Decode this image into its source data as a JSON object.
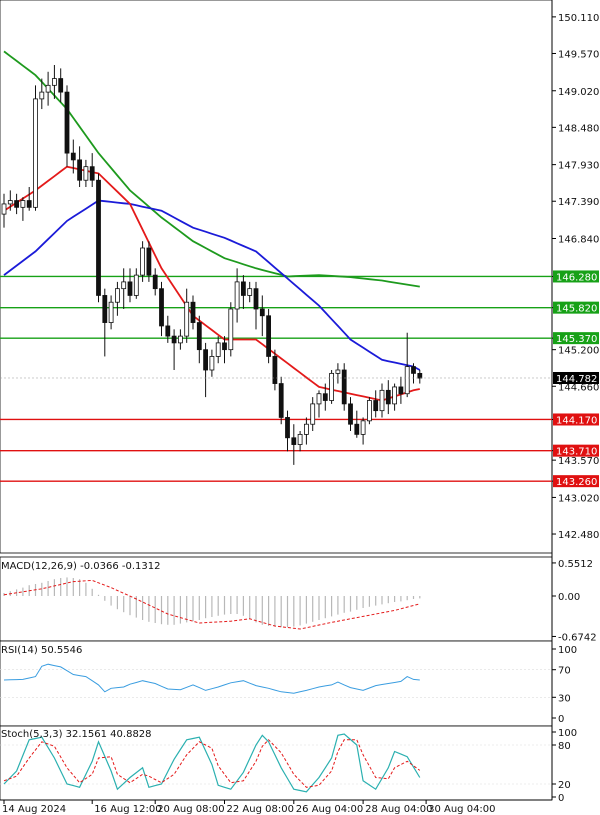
{
  "chart_data": {
    "type": "candlestick",
    "symbol_timeframe": "USDJPY H4",
    "price_axis": {
      "range": [
        142.2,
        150.3
      ],
      "ticks": [
        "150.110",
        "149.570",
        "149.020",
        "148.480",
        "147.930",
        "147.390",
        "146.840",
        "146.280",
        "145.820",
        "145.370",
        "145.200",
        "144.660",
        "144.170",
        "143.710",
        "143.570",
        "143.260",
        "143.020",
        "142.480"
      ],
      "current_price_label": "144.782",
      "current_price": 144.782
    },
    "horizontal_levels": {
      "resistance": [
        146.28,
        145.82,
        145.37
      ],
      "support": [
        144.17,
        143.71,
        143.26
      ],
      "resistance_color": "#17a117",
      "support_color": "#e01010"
    },
    "candles": [
      {
        "o": 147.2,
        "h": 147.5,
        "l": 147.0,
        "c": 147.35
      },
      {
        "o": 147.35,
        "h": 147.55,
        "l": 147.25,
        "c": 147.4
      },
      {
        "o": 147.4,
        "h": 147.5,
        "l": 147.2,
        "c": 147.3
      },
      {
        "o": 147.3,
        "h": 147.45,
        "l": 147.1,
        "c": 147.4
      },
      {
        "o": 147.4,
        "h": 147.6,
        "l": 147.25,
        "c": 147.3
      },
      {
        "o": 147.3,
        "h": 149.1,
        "l": 147.25,
        "c": 148.9
      },
      {
        "o": 148.9,
        "h": 149.2,
        "l": 148.75,
        "c": 149.0
      },
      {
        "o": 149.0,
        "h": 149.3,
        "l": 148.8,
        "c": 149.1
      },
      {
        "o": 149.1,
        "h": 149.4,
        "l": 148.9,
        "c": 149.2
      },
      {
        "o": 149.2,
        "h": 149.35,
        "l": 148.85,
        "c": 149.0
      },
      {
        "o": 149.0,
        "h": 149.1,
        "l": 147.9,
        "c": 148.1
      },
      {
        "o": 148.1,
        "h": 148.3,
        "l": 147.8,
        "c": 148.0
      },
      {
        "o": 148.0,
        "h": 148.2,
        "l": 147.6,
        "c": 147.7
      },
      {
        "o": 147.7,
        "h": 148.0,
        "l": 147.6,
        "c": 147.9
      },
      {
        "o": 147.9,
        "h": 148.1,
        "l": 147.6,
        "c": 147.7
      },
      {
        "o": 147.7,
        "h": 147.8,
        "l": 145.9,
        "c": 146.0
      },
      {
        "o": 146.0,
        "h": 146.1,
        "l": 145.1,
        "c": 145.6
      },
      {
        "o": 145.6,
        "h": 146.0,
        "l": 145.5,
        "c": 145.9
      },
      {
        "o": 145.9,
        "h": 146.2,
        "l": 145.7,
        "c": 146.1
      },
      {
        "o": 146.1,
        "h": 146.4,
        "l": 145.8,
        "c": 146.2
      },
      {
        "o": 146.2,
        "h": 146.4,
        "l": 145.9,
        "c": 146.0
      },
      {
        "o": 146.0,
        "h": 146.4,
        "l": 145.95,
        "c": 146.3
      },
      {
        "o": 146.3,
        "h": 146.8,
        "l": 146.2,
        "c": 146.7
      },
      {
        "o": 146.7,
        "h": 146.8,
        "l": 146.2,
        "c": 146.3
      },
      {
        "o": 146.3,
        "h": 146.4,
        "l": 146.0,
        "c": 146.1
      },
      {
        "o": 146.1,
        "h": 146.2,
        "l": 145.4,
        "c": 145.55
      },
      {
        "o": 145.55,
        "h": 145.7,
        "l": 145.3,
        "c": 145.4
      },
      {
        "o": 145.4,
        "h": 145.5,
        "l": 144.9,
        "c": 145.3
      },
      {
        "o": 145.3,
        "h": 145.5,
        "l": 145.2,
        "c": 145.4
      },
      {
        "o": 145.4,
        "h": 146.1,
        "l": 145.3,
        "c": 145.9
      },
      {
        "o": 145.9,
        "h": 146.0,
        "l": 145.5,
        "c": 145.6
      },
      {
        "o": 145.6,
        "h": 145.7,
        "l": 145.0,
        "c": 145.2
      },
      {
        "o": 145.2,
        "h": 145.3,
        "l": 144.5,
        "c": 144.9
      },
      {
        "o": 144.9,
        "h": 145.2,
        "l": 144.8,
        "c": 145.1
      },
      {
        "o": 145.1,
        "h": 145.4,
        "l": 145.0,
        "c": 145.3
      },
      {
        "o": 145.3,
        "h": 145.4,
        "l": 145.0,
        "c": 145.2
      },
      {
        "o": 145.2,
        "h": 145.9,
        "l": 145.1,
        "c": 145.8
      },
      {
        "o": 145.8,
        "h": 146.4,
        "l": 145.6,
        "c": 146.2
      },
      {
        "o": 146.2,
        "h": 146.3,
        "l": 145.8,
        "c": 146.0
      },
      {
        "o": 146.0,
        "h": 146.2,
        "l": 145.9,
        "c": 146.1
      },
      {
        "o": 146.1,
        "h": 146.2,
        "l": 145.5,
        "c": 145.8
      },
      {
        "o": 145.8,
        "h": 146.0,
        "l": 145.4,
        "c": 145.7
      },
      {
        "o": 145.7,
        "h": 145.8,
        "l": 145.0,
        "c": 145.1
      },
      {
        "o": 145.1,
        "h": 145.2,
        "l": 144.6,
        "c": 144.7
      },
      {
        "o": 144.7,
        "h": 144.8,
        "l": 144.1,
        "c": 144.2
      },
      {
        "o": 144.2,
        "h": 144.3,
        "l": 143.7,
        "c": 143.9
      },
      {
        "o": 143.9,
        "h": 144.1,
        "l": 143.5,
        "c": 143.8
      },
      {
        "o": 143.8,
        "h": 144.0,
        "l": 143.7,
        "c": 143.95
      },
      {
        "o": 143.95,
        "h": 144.2,
        "l": 143.8,
        "c": 144.1
      },
      {
        "o": 144.1,
        "h": 144.5,
        "l": 144.0,
        "c": 144.4
      },
      {
        "o": 144.4,
        "h": 144.6,
        "l": 144.2,
        "c": 144.55
      },
      {
        "o": 144.55,
        "h": 144.7,
        "l": 144.3,
        "c": 144.45
      },
      {
        "o": 144.45,
        "h": 144.9,
        "l": 144.4,
        "c": 144.85
      },
      {
        "o": 144.85,
        "h": 145.0,
        "l": 144.7,
        "c": 144.9
      },
      {
        "o": 144.9,
        "h": 145.0,
        "l": 144.3,
        "c": 144.4
      },
      {
        "o": 144.4,
        "h": 144.5,
        "l": 144.0,
        "c": 144.1
      },
      {
        "o": 144.1,
        "h": 144.3,
        "l": 143.9,
        "c": 143.95
      },
      {
        "o": 143.95,
        "h": 144.2,
        "l": 143.8,
        "c": 144.15
      },
      {
        "o": 144.15,
        "h": 144.5,
        "l": 144.1,
        "c": 144.45
      },
      {
        "o": 144.45,
        "h": 144.6,
        "l": 144.2,
        "c": 144.3
      },
      {
        "o": 144.3,
        "h": 144.7,
        "l": 144.2,
        "c": 144.6
      },
      {
        "o": 144.6,
        "h": 144.75,
        "l": 144.25,
        "c": 144.4
      },
      {
        "o": 144.4,
        "h": 144.7,
        "l": 144.3,
        "c": 144.65
      },
      {
        "o": 144.65,
        "h": 144.8,
        "l": 144.4,
        "c": 144.55
      },
      {
        "o": 144.55,
        "h": 145.45,
        "l": 144.5,
        "c": 144.95
      },
      {
        "o": 144.95,
        "h": 145.0,
        "l": 144.7,
        "c": 144.85
      },
      {
        "o": 144.85,
        "h": 144.9,
        "l": 144.7,
        "c": 144.78
      }
    ],
    "moving_averages": {
      "colors": {
        "ma_fast": "#e41a1a",
        "ma_mid": "#1b1bd8",
        "ma_slow": "#1e9a1e"
      },
      "ma_fast": [
        [
          0,
          147.25
        ],
        [
          5,
          147.55
        ],
        [
          10,
          147.9
        ],
        [
          15,
          147.8
        ],
        [
          20,
          147.35
        ],
        [
          25,
          146.4
        ],
        [
          30,
          145.7
        ],
        [
          35,
          145.35
        ],
        [
          40,
          145.35
        ],
        [
          45,
          145.0
        ],
        [
          50,
          144.65
        ],
        [
          55,
          144.55
        ],
        [
          60,
          144.45
        ],
        [
          65,
          144.6
        ],
        [
          66,
          144.62
        ]
      ],
      "ma_mid": [
        [
          0,
          146.3
        ],
        [
          5,
          146.65
        ],
        [
          10,
          147.1
        ],
        [
          15,
          147.4
        ],
        [
          20,
          147.35
        ],
        [
          25,
          147.25
        ],
        [
          30,
          147.0
        ],
        [
          35,
          146.85
        ],
        [
          40,
          146.65
        ],
        [
          45,
          146.25
        ],
        [
          50,
          145.85
        ],
        [
          55,
          145.35
        ],
        [
          60,
          145.05
        ],
        [
          65,
          144.95
        ],
        [
          66,
          144.9
        ]
      ],
      "ma_slow": [
        [
          0,
          149.6
        ],
        [
          5,
          149.25
        ],
        [
          10,
          148.75
        ],
        [
          15,
          148.1
        ],
        [
          20,
          147.55
        ],
        [
          25,
          147.15
        ],
        [
          30,
          146.8
        ],
        [
          35,
          146.55
        ],
        [
          40,
          146.4
        ],
        [
          45,
          146.28
        ],
        [
          50,
          146.3
        ],
        [
          55,
          146.27
        ],
        [
          60,
          146.22
        ],
        [
          66,
          146.13
        ]
      ]
    },
    "macd": {
      "label": "MACD(12,26,9) -0.0366 -0.1312",
      "ticks": [
        "0.5512",
        "0.00",
        "-0.6742"
      ],
      "range": [
        -0.7,
        0.6
      ],
      "histogram": [
        0.05,
        0.08,
        0.11,
        0.14,
        0.18,
        0.2,
        0.22,
        0.25,
        0.28,
        0.3,
        0.31,
        0.3,
        0.28,
        0.22,
        0.12,
        0.02,
        -0.08,
        -0.16,
        -0.22,
        -0.27,
        -0.32,
        -0.36,
        -0.4,
        -0.43,
        -0.45,
        -0.47,
        -0.48,
        -0.48,
        -0.46,
        -0.44,
        -0.42,
        -0.4,
        -0.37,
        -0.35,
        -0.33,
        -0.31,
        -0.3,
        -0.3,
        -0.33,
        -0.38,
        -0.44,
        -0.48,
        -0.5,
        -0.51,
        -0.52,
        -0.52,
        -0.51,
        -0.49,
        -0.46,
        -0.43,
        -0.4,
        -0.37,
        -0.34,
        -0.31,
        -0.28,
        -0.26,
        -0.23,
        -0.2,
        -0.18,
        -0.16,
        -0.14,
        -0.12,
        -0.1,
        -0.09,
        -0.07,
        -0.05,
        -0.04
      ],
      "signal": [
        [
          0,
          0.02
        ],
        [
          6,
          0.12
        ],
        [
          11,
          0.24
        ],
        [
          14,
          0.26
        ],
        [
          17,
          0.14
        ],
        [
          21,
          -0.05
        ],
        [
          26,
          -0.3
        ],
        [
          31,
          -0.45
        ],
        [
          36,
          -0.42
        ],
        [
          39,
          -0.38
        ],
        [
          43,
          -0.5
        ],
        [
          47,
          -0.55
        ],
        [
          52,
          -0.44
        ],
        [
          57,
          -0.34
        ],
        [
          62,
          -0.24
        ],
        [
          66,
          -0.13
        ]
      ]
    },
    "rsi": {
      "label": "RSI(14) 50.5546",
      "ticks": [
        "100",
        "70",
        "30",
        "0"
      ],
      "range": [
        0,
        100
      ],
      "values": [
        [
          0,
          55
        ],
        [
          3,
          56
        ],
        [
          5,
          60
        ],
        [
          6,
          75
        ],
        [
          7,
          78
        ],
        [
          9,
          74
        ],
        [
          11,
          63
        ],
        [
          13,
          60
        ],
        [
          15,
          48
        ],
        [
          16,
          38
        ],
        [
          17,
          43
        ],
        [
          19,
          45
        ],
        [
          20,
          49
        ],
        [
          22,
          54
        ],
        [
          24,
          50
        ],
        [
          26,
          42
        ],
        [
          28,
          41
        ],
        [
          30,
          48
        ],
        [
          32,
          40
        ],
        [
          34,
          45
        ],
        [
          36,
          51
        ],
        [
          38,
          54
        ],
        [
          40,
          47
        ],
        [
          42,
          43
        ],
        [
          44,
          38
        ],
        [
          46,
          36
        ],
        [
          48,
          40
        ],
        [
          50,
          45
        ],
        [
          52,
          48
        ],
        [
          53,
          52
        ],
        [
          55,
          44
        ],
        [
          57,
          40
        ],
        [
          59,
          47
        ],
        [
          61,
          50
        ],
        [
          63,
          53
        ],
        [
          64,
          60
        ],
        [
          65,
          56
        ],
        [
          66,
          55
        ]
      ]
    },
    "stochastic": {
      "label": "Stoch(5,3,3) 32.1561 40.8828",
      "ticks": [
        "100",
        "80",
        "20",
        "0"
      ],
      "range": [
        0,
        100
      ],
      "k": [
        [
          0,
          20
        ],
        [
          2,
          40
        ],
        [
          4,
          88
        ],
        [
          6,
          92
        ],
        [
          8,
          60
        ],
        [
          10,
          20
        ],
        [
          12,
          15
        ],
        [
          14,
          55
        ],
        [
          15,
          85
        ],
        [
          17,
          40
        ],
        [
          18,
          12
        ],
        [
          20,
          30
        ],
        [
          22,
          45
        ],
        [
          23,
          15
        ],
        [
          25,
          20
        ],
        [
          27,
          58
        ],
        [
          29,
          88
        ],
        [
          31,
          92
        ],
        [
          33,
          50
        ],
        [
          34,
          18
        ],
        [
          36,
          12
        ],
        [
          38,
          38
        ],
        [
          40,
          80
        ],
        [
          41,
          95
        ],
        [
          42,
          85
        ],
        [
          44,
          45
        ],
        [
          46,
          12
        ],
        [
          48,
          8
        ],
        [
          50,
          30
        ],
        [
          52,
          60
        ],
        [
          53,
          95
        ],
        [
          54,
          97
        ],
        [
          56,
          80
        ],
        [
          57,
          25
        ],
        [
          59,
          12
        ],
        [
          61,
          45
        ],
        [
          62,
          70
        ],
        [
          64,
          62
        ],
        [
          66,
          30
        ]
      ],
      "d": [
        [
          0,
          25
        ],
        [
          2,
          32
        ],
        [
          4,
          60
        ],
        [
          6,
          85
        ],
        [
          8,
          78
        ],
        [
          10,
          45
        ],
        [
          12,
          22
        ],
        [
          14,
          35
        ],
        [
          15,
          60
        ],
        [
          17,
          62
        ],
        [
          18,
          35
        ],
        [
          20,
          22
        ],
        [
          22,
          35
        ],
        [
          23,
          32
        ],
        [
          25,
          22
        ],
        [
          27,
          35
        ],
        [
          29,
          65
        ],
        [
          31,
          85
        ],
        [
          33,
          75
        ],
        [
          34,
          48
        ],
        [
          36,
          22
        ],
        [
          38,
          25
        ],
        [
          40,
          55
        ],
        [
          41,
          78
        ],
        [
          42,
          88
        ],
        [
          44,
          68
        ],
        [
          46,
          35
        ],
        [
          48,
          15
        ],
        [
          50,
          18
        ],
        [
          52,
          40
        ],
        [
          53,
          70
        ],
        [
          54,
          88
        ],
        [
          56,
          88
        ],
        [
          57,
          65
        ],
        [
          59,
          30
        ],
        [
          61,
          28
        ],
        [
          62,
          45
        ],
        [
          64,
          55
        ],
        [
          66,
          41
        ]
      ]
    },
    "x_axis": {
      "labels": [
        "14 Aug 2024",
        "16 Aug 12:00",
        "20 Aug 08:00",
        "22 Aug 08:00",
        "26 Aug 04:00",
        "28 Aug 04:00",
        "30 Aug 04:00"
      ],
      "label_bar_index": [
        0,
        14,
        24,
        35,
        46,
        57,
        67
      ]
    }
  }
}
